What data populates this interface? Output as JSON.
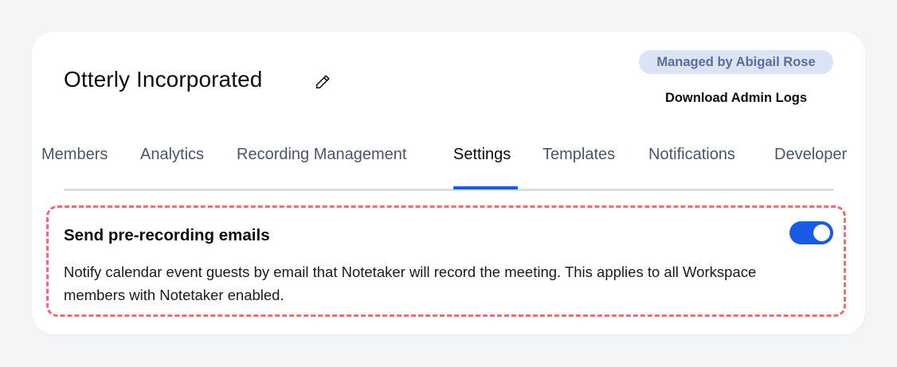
{
  "header": {
    "org_name": "Otterly Incorporated",
    "managed_by": "Managed by Abigail Rose",
    "download_logs": "Download Admin Logs"
  },
  "tabs": [
    {
      "label": "Members",
      "active": false
    },
    {
      "label": "Analytics",
      "active": false
    },
    {
      "label": "Recording Management",
      "active": false
    },
    {
      "label": "Settings",
      "active": true
    },
    {
      "label": "Templates",
      "active": false
    },
    {
      "label": "Notifications",
      "active": false
    },
    {
      "label": "Developer",
      "active": false
    }
  ],
  "setting": {
    "title": "Send pre-recording emails",
    "description": "Notify calendar event guests by email that Notetaker will record the meeting. This applies to all Workspace members with Notetaker enabled.",
    "enabled": true
  },
  "colors": {
    "accent": "#1a5be6",
    "badge_bg": "#dbe3f7",
    "badge_text": "#5d6d94",
    "highlight_border": "#ec6c78"
  },
  "icons": {
    "edit": "pencil-icon"
  }
}
